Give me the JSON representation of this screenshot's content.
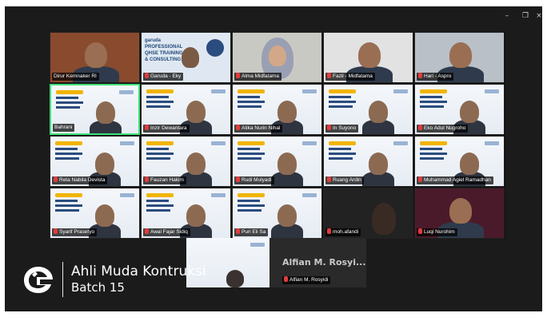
{
  "window": {
    "controls": {
      "minimize": "–",
      "restore": "❐",
      "close": "×"
    }
  },
  "tiles": [
    {
      "name": "Dirur Kemnaker RI",
      "muted": false,
      "bg": "#8a4a2e",
      "kind": "person"
    },
    {
      "name": "Garuda - Eky",
      "muted": true,
      "bg": "#dfe8f2",
      "kind": "banner"
    },
    {
      "name": "Alma Midfatama",
      "muted": true,
      "bg": "#c9c9c4",
      "kind": "hijab"
    },
    {
      "name": "Fazil - Midfatama",
      "muted": true,
      "bg": "#e2e2e2",
      "kind": "person"
    },
    {
      "name": "Hari - Aspro",
      "muted": true,
      "bg": "#b9c0c8",
      "kind": "person"
    },
    {
      "name": "Bahrani",
      "muted": false,
      "bg": "#dde6ee",
      "kind": "slide",
      "active": true
    },
    {
      "name": "Inzir Dewantara",
      "muted": true,
      "bg": "#dde6ee",
      "kind": "slide"
    },
    {
      "name": "Atika Nurin Nihal",
      "muted": true,
      "bg": "#dde6ee",
      "kind": "slide"
    },
    {
      "name": "In Suyono",
      "muted": true,
      "bg": "#dde6ee",
      "kind": "slide"
    },
    {
      "name": "Eko Adul Nugroho",
      "muted": true,
      "bg": "#dde6ee",
      "kind": "slide"
    },
    {
      "name": "Reta Nabila Devista",
      "muted": true,
      "bg": "#dde6ee",
      "kind": "slide"
    },
    {
      "name": "Fauzan Hakim",
      "muted": true,
      "bg": "#dde6ee",
      "kind": "slide"
    },
    {
      "name": "Rudi Mulyadi",
      "muted": true,
      "bg": "#dde6ee",
      "kind": "slide"
    },
    {
      "name": "Ruang Ardin",
      "muted": true,
      "bg": "#dde6ee",
      "kind": "slide"
    },
    {
      "name": "Muhammad Agiel Ramadhan",
      "muted": true,
      "bg": "#dde6ee",
      "kind": "slide"
    },
    {
      "name": "Syarif Prasetyo",
      "muted": true,
      "bg": "#dde6ee",
      "kind": "slide"
    },
    {
      "name": "Awal Fajar Sidiq",
      "muted": true,
      "bg": "#dde6ee",
      "kind": "slide"
    },
    {
      "name": "Puri Eli Sa",
      "muted": true,
      "bg": "#dde6ee",
      "kind": "slide"
    },
    {
      "name": "moh.afandi",
      "muted": true,
      "bg": "#222222",
      "kind": "dark"
    },
    {
      "name": "Luqi Nurohim",
      "muted": true,
      "bg": "#4b1a2a",
      "kind": "person"
    }
  ],
  "bottom_tile": {
    "display_name": "Alfian M. Rosyi...",
    "tag": "Alfian M. Rosyidi"
  },
  "banner_text": {
    "brand": "garuda",
    "line1": "PROFESSIONAL",
    "line2": "QHSE TRAINING",
    "line3": "& CONSULTING"
  },
  "overlay": {
    "line1": "Ahli Muda Kontruksi",
    "line2": "Batch 15"
  },
  "colors": {
    "active_border": "#3fe07a",
    "mic_muted": "#e23b3b"
  }
}
